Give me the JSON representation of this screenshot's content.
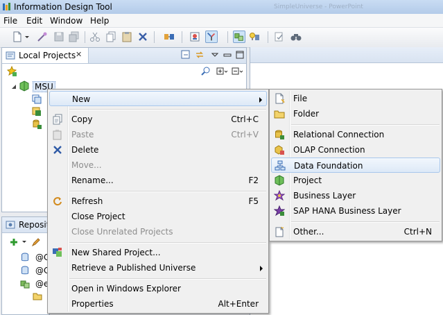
{
  "window": {
    "title": "Information Design Tool",
    "background_title": "SimpleUniverse - PowerPoint"
  },
  "menubar": [
    "File",
    "Edit",
    "Window",
    "Help"
  ],
  "local_projects": {
    "tab_label": "Local Projects",
    "project": "MSU"
  },
  "repository": {
    "tab_label": "Reposito",
    "items": [
      "@C",
      "@C",
      "@e"
    ]
  },
  "context_menu": {
    "items": [
      {
        "label": "New",
        "shortcut": "",
        "submenu": true,
        "icon": "none",
        "disabled": false,
        "highlighted": true
      },
      {
        "label": "Copy",
        "shortcut": "Ctrl+C",
        "icon": "copy-icon",
        "disabled": false
      },
      {
        "label": "Paste",
        "shortcut": "Ctrl+V",
        "icon": "paste-icon",
        "disabled": true
      },
      {
        "label": "Delete",
        "shortcut": "",
        "icon": "delete-icon",
        "disabled": false
      },
      {
        "label": "Move...",
        "shortcut": "",
        "icon": "none",
        "disabled": true
      },
      {
        "label": "Rename...",
        "shortcut": "F2",
        "icon": "none",
        "disabled": false
      },
      {
        "label": "Refresh",
        "shortcut": "F5",
        "icon": "refresh-icon",
        "disabled": false
      },
      {
        "label": "Close Project",
        "shortcut": "",
        "icon": "none",
        "disabled": false
      },
      {
        "label": "Close Unrelated Projects",
        "shortcut": "",
        "icon": "none",
        "disabled": true
      },
      {
        "label": "New Shared Project...",
        "shortcut": "",
        "icon": "shared-project-icon",
        "disabled": false
      },
      {
        "label": "Retrieve a Published Universe",
        "shortcut": "",
        "submenu": true,
        "icon": "none",
        "disabled": false
      },
      {
        "label": "Open in Windows Explorer",
        "shortcut": "",
        "icon": "none",
        "disabled": false
      },
      {
        "label": "Properties",
        "shortcut": "Alt+Enter",
        "icon": "none",
        "disabled": false
      }
    ]
  },
  "new_submenu": {
    "items": [
      {
        "label": "File",
        "shortcut": "",
        "icon": "new-file-icon"
      },
      {
        "label": "Folder",
        "shortcut": "",
        "icon": "folder-icon"
      },
      {
        "label": "Relational Connection",
        "shortcut": "",
        "icon": "relational-connection-icon"
      },
      {
        "label": "OLAP Connection",
        "shortcut": "",
        "icon": "olap-connection-icon"
      },
      {
        "label": "Data Foundation",
        "shortcut": "",
        "icon": "data-foundation-icon",
        "highlighted": true
      },
      {
        "label": "Project",
        "shortcut": "",
        "icon": "project-icon"
      },
      {
        "label": "Business Layer",
        "shortcut": "",
        "icon": "business-layer-icon"
      },
      {
        "label": "SAP HANA Business Layer",
        "shortcut": "",
        "icon": "hana-business-layer-icon"
      },
      {
        "label": "Other...",
        "shortcut": "Ctrl+N",
        "icon": "other-wizard-icon"
      }
    ]
  },
  "colors": {
    "highlight_border": "#a8c7ec",
    "menu_bg": "#f0f0f0",
    "title_bg": "#c9dcf3"
  }
}
